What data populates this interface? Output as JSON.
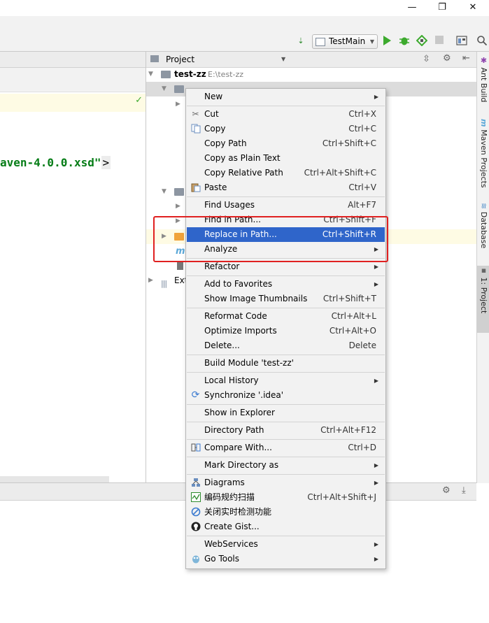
{
  "window": {
    "minimize": "—",
    "maximize": "❐",
    "close": "✕"
  },
  "toolbar": {
    "run_config": "TestMain"
  },
  "editor": {
    "code": "aven-4.0.0.xsd\"",
    "bracket": ">",
    "check": "✓"
  },
  "project": {
    "header": "Project",
    "root_name": "test-zz",
    "root_path": "E:\\test-zz",
    "ext_label": "Ext"
  },
  "rightbar": {
    "tabs": [
      "Ant Build",
      "Maven Projects",
      "Database",
      "1: Project"
    ]
  },
  "menu": {
    "items": [
      {
        "label": "New",
        "shortcut": "",
        "sub": true
      },
      {
        "label": "Cut",
        "shortcut": "Ctrl+X"
      },
      {
        "label": "Copy",
        "shortcut": "Ctrl+C"
      },
      {
        "label": "Copy Path",
        "shortcut": "Ctrl+Shift+C"
      },
      {
        "label": "Copy as Plain Text",
        "shortcut": ""
      },
      {
        "label": "Copy Relative Path",
        "shortcut": "Ctrl+Alt+Shift+C"
      },
      {
        "label": "Paste",
        "shortcut": "Ctrl+V"
      },
      {
        "label": "Find Usages",
        "shortcut": "Alt+F7"
      },
      {
        "label": "Find in Path...",
        "shortcut": "Ctrl+Shift+F"
      },
      {
        "label": "Replace in Path...",
        "shortcut": "Ctrl+Shift+R"
      },
      {
        "label": "Analyze",
        "shortcut": "",
        "sub": true
      },
      {
        "label": "Refactor",
        "shortcut": "",
        "sub": true
      },
      {
        "label": "Add to Favorites",
        "shortcut": "",
        "sub": true
      },
      {
        "label": "Show Image Thumbnails",
        "shortcut": "Ctrl+Shift+T"
      },
      {
        "label": "Reformat Code",
        "shortcut": "Ctrl+Alt+L"
      },
      {
        "label": "Optimize Imports",
        "shortcut": "Ctrl+Alt+O"
      },
      {
        "label": "Delete...",
        "shortcut": "Delete"
      },
      {
        "label": "Build Module 'test-zz'",
        "shortcut": ""
      },
      {
        "label": "Local History",
        "shortcut": "",
        "sub": true
      },
      {
        "label": "Synchronize '.idea'",
        "shortcut": ""
      },
      {
        "label": "Show in Explorer",
        "shortcut": ""
      },
      {
        "label": "Directory Path",
        "shortcut": "Ctrl+Alt+F12"
      },
      {
        "label": "Compare With...",
        "shortcut": "Ctrl+D"
      },
      {
        "label": "Mark Directory as",
        "shortcut": "",
        "sub": true
      },
      {
        "label": "Diagrams",
        "shortcut": "",
        "sub": true
      },
      {
        "label": "编码规约扫描",
        "shortcut": "Ctrl+Alt+Shift+J"
      },
      {
        "label": "关闭实时检测功能",
        "shortcut": ""
      },
      {
        "label": "Create Gist...",
        "shortcut": ""
      },
      {
        "label": "WebServices",
        "shortcut": "",
        "sub": true
      },
      {
        "label": "Go Tools",
        "shortcut": "",
        "sub": true
      }
    ]
  },
  "colors": {
    "selection": "#2f65ca",
    "highlight_box": "#e02020",
    "run_green": "#3daa2e"
  }
}
